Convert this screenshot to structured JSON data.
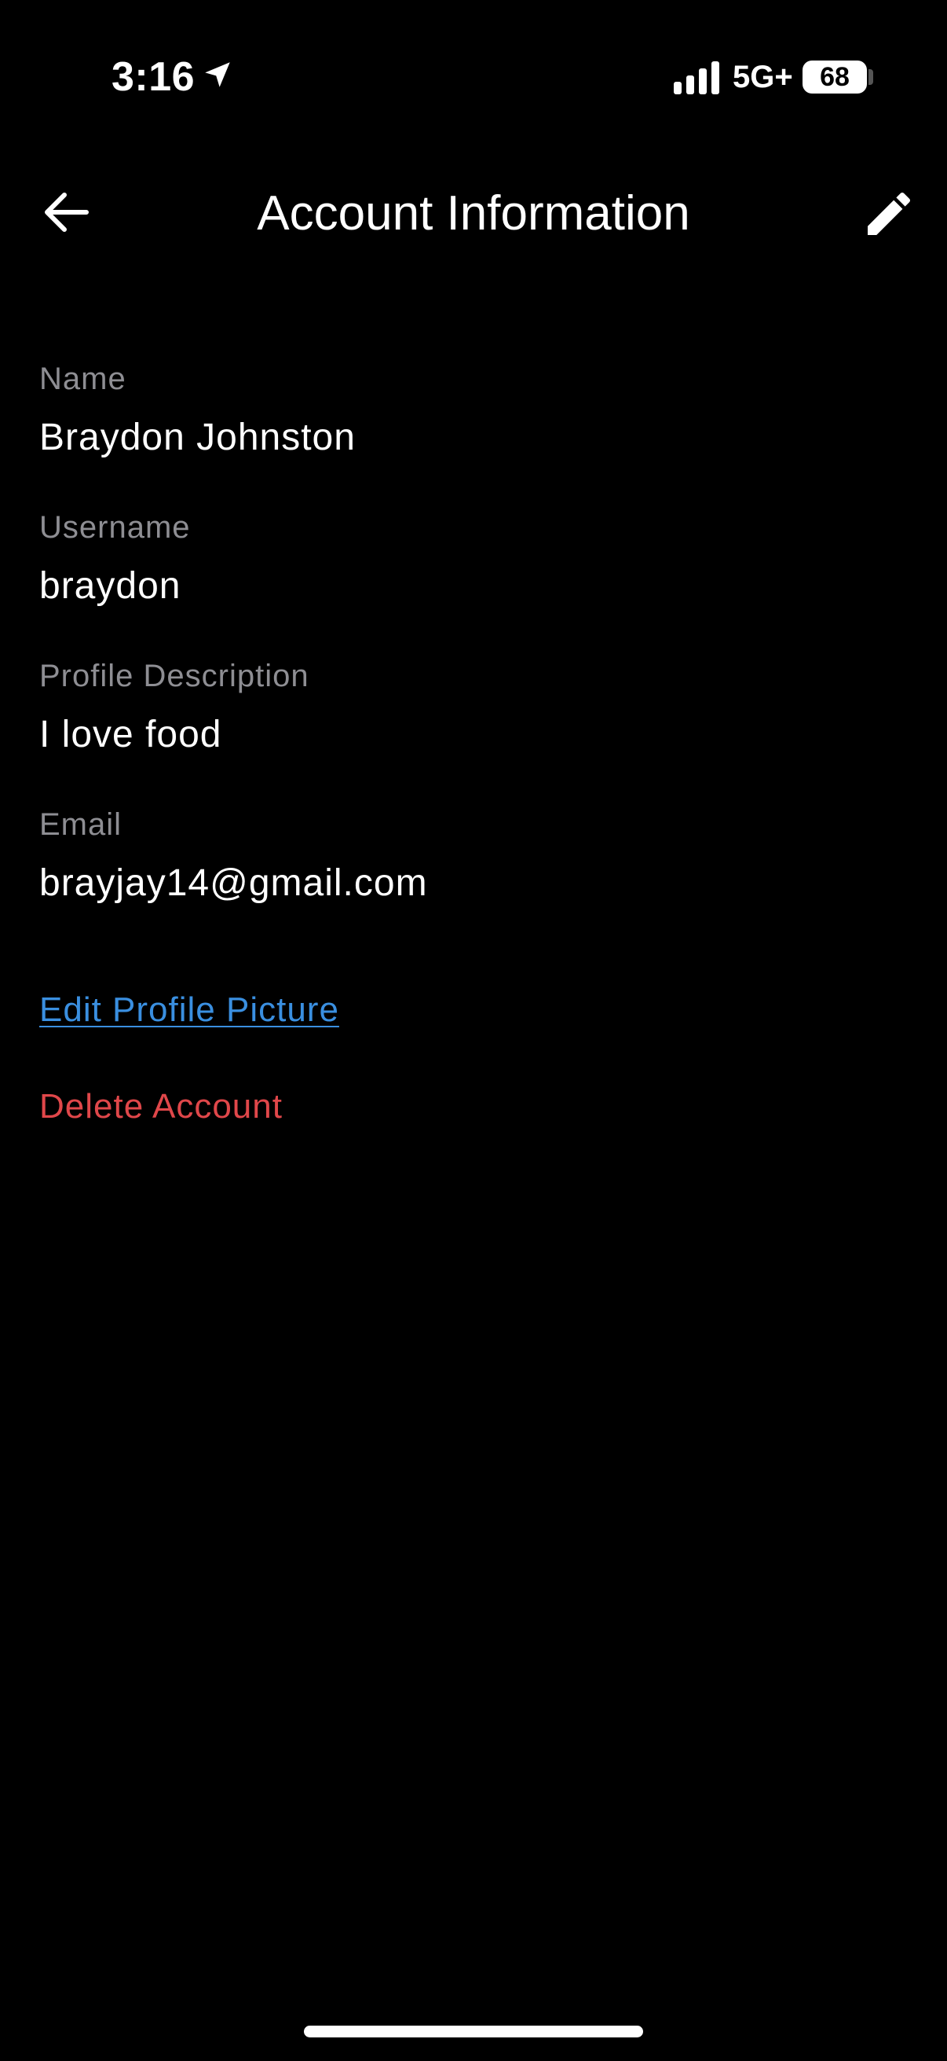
{
  "status_bar": {
    "time": "3:16",
    "network": "5G+",
    "battery": "68"
  },
  "header": {
    "title": "Account Information",
    "back_icon": "arrow-left-icon",
    "edit_icon": "pencil-icon"
  },
  "fields": [
    {
      "label": "Name",
      "value": "Braydon Johnston"
    },
    {
      "label": "Username",
      "value": "braydon"
    },
    {
      "label": "Profile Description",
      "value": "I love food"
    },
    {
      "label": "Email",
      "value": "brayjay14@gmail.com"
    }
  ],
  "actions": {
    "edit_picture": "Edit Profile Picture",
    "delete_account": "Delete Account"
  },
  "colors": {
    "link": "#3a8fe0",
    "danger": "#e0474a",
    "label": "#8e8e93"
  }
}
